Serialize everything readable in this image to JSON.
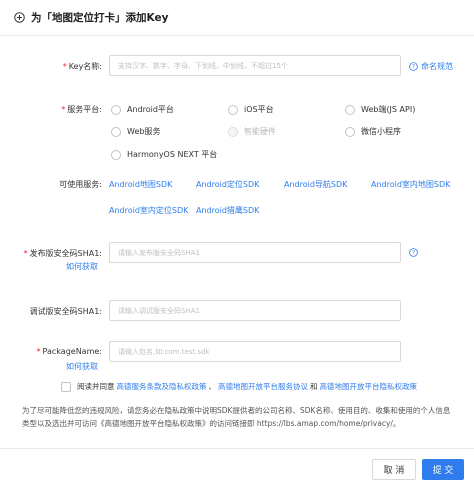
{
  "dialog": {
    "title": "为「地图定位打卡」添加Key",
    "colors": {
      "primary": "#2f7dec",
      "required": "#f5222d",
      "border": "#d9d9d9"
    }
  },
  "key_name": {
    "label": "Key名称:",
    "placeholder": "支持汉字、数字、字母、下划线、中划线，不超过15个",
    "help_link": "命名规范"
  },
  "service_platform": {
    "label": "服务平台:",
    "options": [
      {
        "label": "Android平台",
        "disabled": false
      },
      {
        "label": "iOS平台",
        "disabled": false
      },
      {
        "label": "Web端(JS API)",
        "disabled": false
      },
      {
        "label": "Web服务",
        "disabled": false
      },
      {
        "label": "智能硬件",
        "disabled": true
      },
      {
        "label": "微信小程序",
        "disabled": false
      },
      {
        "label": "HarmonyOS NEXT 平台",
        "disabled": false
      }
    ]
  },
  "available_services": {
    "label": "可使用服务:",
    "items": [
      "Android地图SDK",
      "Android定位SDK",
      "Android导航SDK",
      "Android室内地图SDK",
      "Android室内定位SDK",
      "Android猎鹰SDK"
    ]
  },
  "release_sha1": {
    "label": "发布版安全码SHA1:",
    "placeholder": "请输入发布版安全码SHA1",
    "how_link": "如何获取"
  },
  "debug_sha1": {
    "label": "调试版安全码SHA1:",
    "placeholder": "请输入调试版安全码SHA1"
  },
  "package_name": {
    "label": "PackageName:",
    "placeholder": "请输入包名,如:com.test.sdk",
    "how_link": "如何获取"
  },
  "agreement": {
    "prefix": "阅读并同意",
    "link1": "高德服务条款及隐私权政策",
    "sep1": "、",
    "link2": "高德地图开放平台服务协议",
    "sep2": "和",
    "link3": "高德地图开放平台隐私权政策"
  },
  "notice": "为了尽可能降低您的违规风险，请您务必在隐私政策中说明SDK提供者的公司名称、SDK名称、使用目的、收集和使用的个人信息类型以及选出并可访问《高德地图开放平台隐私权政策》的访问链接即 https://lbs.amap.com/home/privacy/。",
  "footer": {
    "cancel": "取 消",
    "submit": "提 交"
  }
}
